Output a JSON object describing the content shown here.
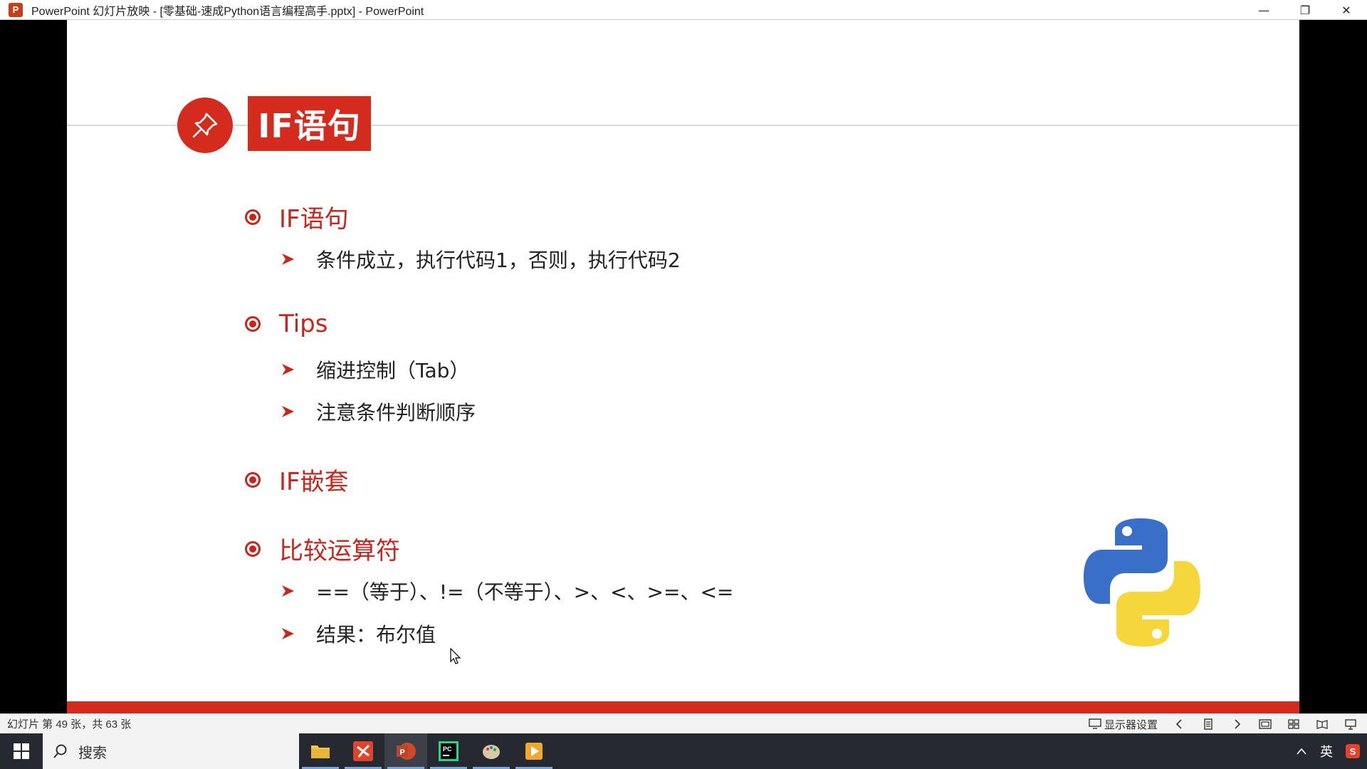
{
  "window": {
    "app_icon_letter": "P",
    "title": "PowerPoint 幻灯片放映 - [零基础-速成Python语言编程高手.pptx] - PowerPoint",
    "minimize_symbol": "—",
    "restore_symbol": "❐",
    "close_symbol": "✕"
  },
  "slide": {
    "title": "IF语句",
    "sections": [
      {
        "heading": "IF语句",
        "items": [
          "条件成立，执行代码1，否则，执行代码2"
        ]
      },
      {
        "heading": "Tips",
        "items": [
          "缩进控制（Tab）",
          "注意条件判断顺序"
        ]
      },
      {
        "heading": "IF嵌套",
        "items": []
      },
      {
        "heading": "比较运算符",
        "items": [
          "==（等于）、!=（不等于）、>、<、>=、<=",
          "结果：布尔值"
        ]
      }
    ],
    "accent_color": "#d42b1f"
  },
  "statusbar": {
    "slide_count": "幻灯片 第 49 张，共 63 张",
    "display_settings": "显示器设置"
  },
  "taskbar": {
    "search_label": "搜索",
    "tray_ime": "英"
  }
}
